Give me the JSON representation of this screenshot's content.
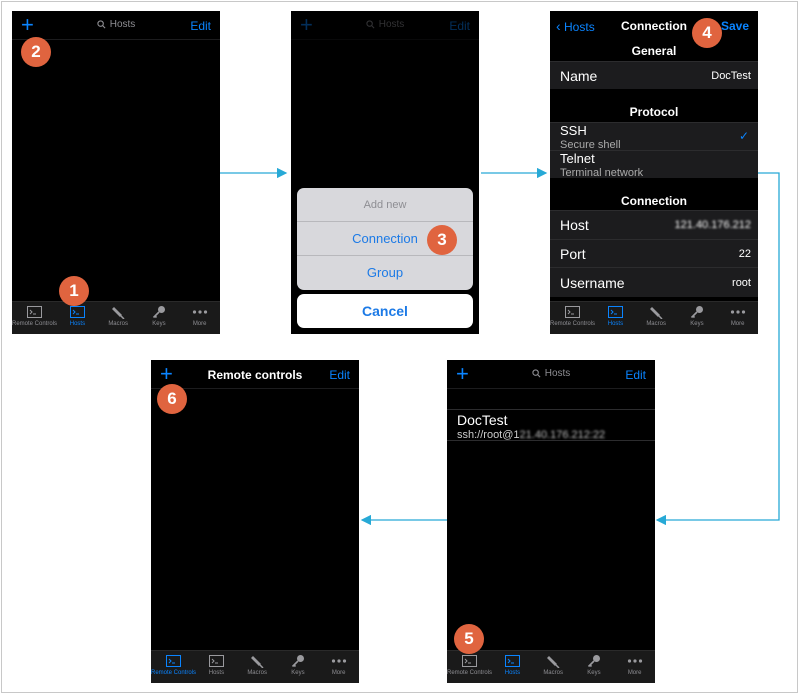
{
  "tab_labels": [
    "Remote Controls",
    "Hosts",
    "Macros",
    "Keys",
    "More"
  ],
  "tab_icons": [
    "terminal-icon",
    "terminal-icon",
    "macro-icon",
    "key-icon",
    "more-icon"
  ],
  "accent_color": "#0a84ff",
  "badge_color": "#e0643f",
  "screen1": {
    "plus": "+",
    "search": "Hosts",
    "edit": "Edit",
    "badge_top": "2",
    "badge_bottom": "1",
    "active_tab": "Hosts"
  },
  "screen2": {
    "plus": "+",
    "search": "Hosts",
    "edit": "Edit",
    "sheet_header": "Add new",
    "options": [
      "Connection",
      "Group"
    ],
    "cancel": "Cancel",
    "badge": "3"
  },
  "screen3": {
    "back": "Hosts",
    "title": "Connection",
    "save": "Save",
    "badge": "4",
    "section_general": "General",
    "name_label": "Name",
    "name_value": "DocTest",
    "section_protocol": "Protocol",
    "ssh_label": "SSH",
    "ssh_sub": "Secure shell",
    "telnet_label": "Telnet",
    "telnet_sub": "Terminal network",
    "section_connection": "Connection",
    "host_label": "Host",
    "host_value": "121.40.176.212",
    "port_label": "Port",
    "port_value": "22",
    "username_label": "Username",
    "username_value": "root",
    "active_tab": "Hosts"
  },
  "screen4": {
    "plus": "+",
    "search": "Hosts",
    "edit": "Edit",
    "host_name": "DocTest",
    "host_url_prefix": "ssh://root@1",
    "host_url_blurred": "21.40.176.212:22",
    "badge": "5",
    "active_tab": "Hosts"
  },
  "screen5": {
    "plus": "+",
    "title": "Remote controls",
    "edit": "Edit",
    "badge": "6",
    "active_tab": "Remote Controls"
  }
}
